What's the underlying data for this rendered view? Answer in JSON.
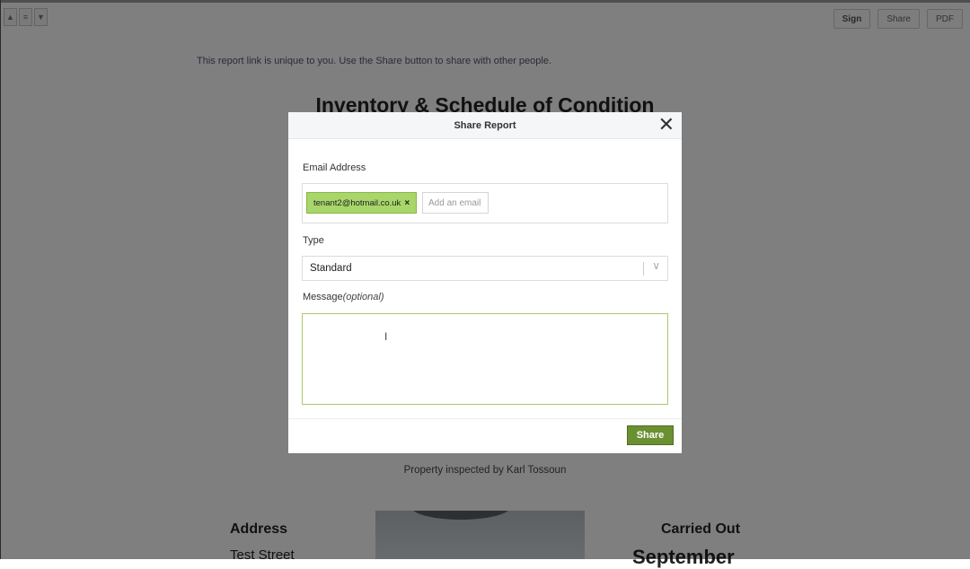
{
  "toolbar": {
    "up_icon": "▲",
    "menu_icon": "≡",
    "down_icon": "▼",
    "sign_label": "Sign",
    "share_label": "Share",
    "pdf_label": "PDF"
  },
  "page": {
    "notice": "This report link is unique to you. Use the Share button to share with other people.",
    "title": "Inventory & Schedule of Condition",
    "inspected_by": "Property inspected by Karl Tossoun",
    "address_label": "Address",
    "address_value": "Test Street",
    "carried_out_label": "Carried Out",
    "carried_out_value": "September"
  },
  "modal": {
    "title": "Share Report",
    "close_icon": "✕",
    "email_label": "Email Address",
    "email_chips": [
      {
        "email": "tenant2@hotmail.co.uk",
        "remove": "×"
      }
    ],
    "email_placeholder": "Add an email",
    "type_label": "Type",
    "type_value": "Standard",
    "type_chevron": "∨",
    "message_label": "Message",
    "message_optional": "(optional)",
    "message_value": "",
    "cursor_glyph": "I",
    "share_button": "Share"
  },
  "colors": {
    "accent_green": "#a8d66a",
    "button_green": "#6b9032",
    "overlay": "rgba(0,0,0,0.5)"
  }
}
